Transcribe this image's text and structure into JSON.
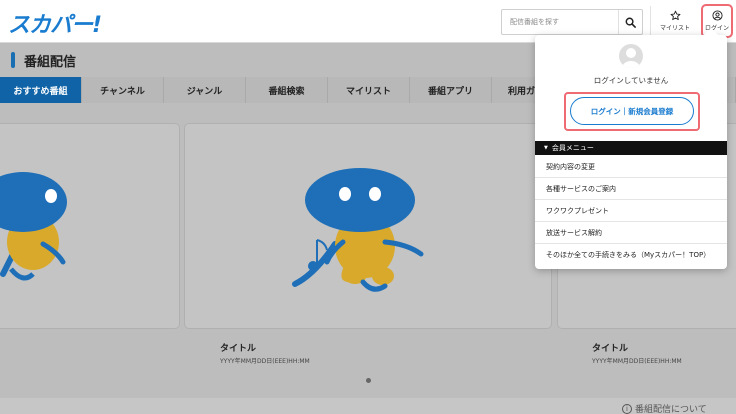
{
  "header": {
    "logo": "スカパー!",
    "search": {
      "placeholder": "配信番組を探す",
      "value": ""
    },
    "mylist_label": "マイリスト",
    "login_label": "ログイン"
  },
  "page": {
    "title": "番組配信"
  },
  "tabs": [
    {
      "label": "おすすめ番組",
      "active": true
    },
    {
      "label": "チャンネル"
    },
    {
      "label": "ジャンル"
    },
    {
      "label": "番組検索"
    },
    {
      "label": "マイリスト"
    },
    {
      "label": "番組アプリ"
    },
    {
      "label": "利用ガイド"
    }
  ],
  "cards": [
    {
      "title": "",
      "date": ""
    },
    {
      "title": "タイトル",
      "date": "YYYY年MM月DD日(EEE)HH:MM"
    },
    {
      "title": "タイトル",
      "date": "YYYY年MM月DD日(EEE)HH:MM"
    }
  ],
  "footer": {
    "about": "番組配信について"
  },
  "dropdown": {
    "status": "ログインしていません",
    "login_button": "ログイン｜新規会員登録",
    "menu_title": "会員メニュー",
    "menu_items": [
      "契約内容の変更",
      "各種サービスのご案内",
      "ワクワクプレゼント",
      "放送サービス解約",
      "そのほか全ての手続きをみる（Myスカパー！TOP）"
    ]
  },
  "colors": {
    "brand": "#1a7ccf",
    "tab_active": "#0f63a6",
    "highlight": "#ef6b73",
    "mascot_blue": "#1e6fb8",
    "mascot_yellow": "#d8a92a"
  },
  "icons": {
    "search": "search-icon",
    "mylist": "star-icon",
    "login": "user-circle-icon",
    "about": "info-icon"
  }
}
